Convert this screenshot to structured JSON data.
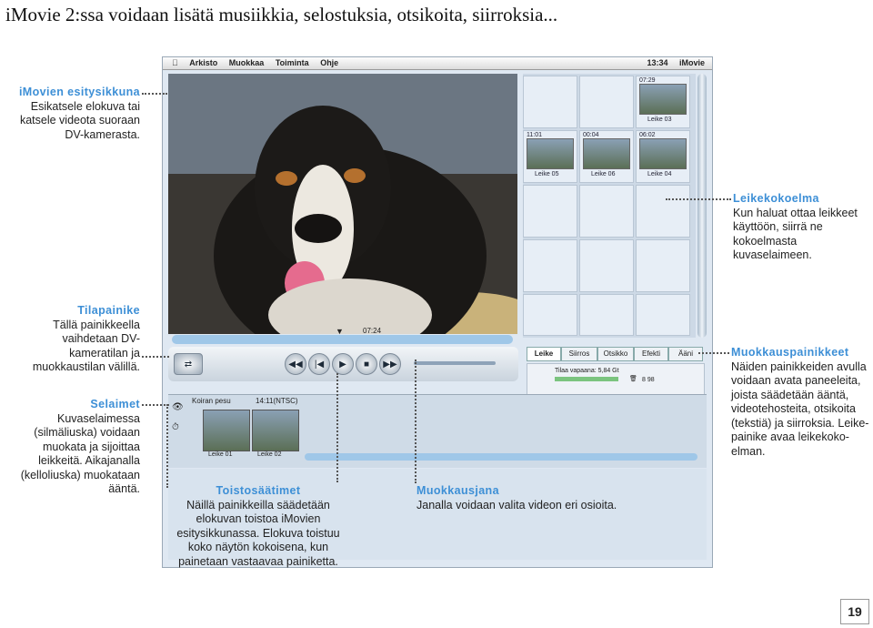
{
  "heading": "iMovie 2:ssa voidaan lisätä musiikkia, selostuksia, otsikoita, siirroksia...",
  "annotations": {
    "esitysikkuna": {
      "title": "iMovien esitysikkuna",
      "text": "Esikatsele elokuva tai katsele videota suoraan DV-kamerasta."
    },
    "leikekokoelma": {
      "title": "Leikekokoelma",
      "text": "Kun haluat ottaa leikkeet käyttöön, siirrä ne kokoelmasta kuvaselaimeen."
    },
    "tilapainike": {
      "title": "Tilapainike",
      "text": "Tällä painikkeella vaihdetaan DV-kameratilan ja muokkaustilan välillä."
    },
    "muokkauspainikkeet": {
      "title": "Muokkauspainikkeet",
      "text": "Näiden painikkeiden avulla voidaan avata paneeleita, joista säädetään ääntä, videotehosteita, otsikoita (tekstiä) ja siirroksia. Leike-painike avaa leikekoko-elman."
    },
    "selaimet": {
      "title": "Selaimet",
      "text": "Kuvaselaimessa (silmäliuska) voidaan muokata ja sijoittaa leikkeitä. Aikajanalla (kelloliuska) muokataan ääntä."
    },
    "toistosaatimet": {
      "title": "Toistosäätimet",
      "text": "Näillä painikkeilla säädetään elokuvan toistoa iMovien esitysikkunassa. Elokuva toistuu koko näytön kokoisena, kun painetaan vastaavaa painiketta."
    },
    "muokkausjana": {
      "title": "Muokkausjana",
      "text": "Janalla voidaan valita videon eri osioita."
    }
  },
  "screen": {
    "menu": [
      "Arkisto",
      "Muokkaa",
      "Toiminta",
      "Ohje"
    ],
    "clock": "13:34",
    "app": "iMovie",
    "timecode": "07:24",
    "clips_collection": [
      {
        "time": "07:29",
        "label": "Leike 03"
      },
      {
        "time": "11:01",
        "label": "Leike 05"
      },
      {
        "time": "00:04",
        "label": "Leike 06"
      },
      {
        "time": "06:02",
        "label": "Leike 04"
      }
    ],
    "tabs": [
      "Leike",
      "Siirros",
      "Otsikko",
      "Efekti",
      "Ääni"
    ],
    "disk_free": "Tilaa vapaana: 5,84 Gt",
    "disk_size": "8 98",
    "track_title": "Koiran pesu",
    "track_time": "14:11(NTSC)",
    "track_clips": [
      "Leike 01",
      "Leike 02"
    ]
  },
  "page_number": "19"
}
